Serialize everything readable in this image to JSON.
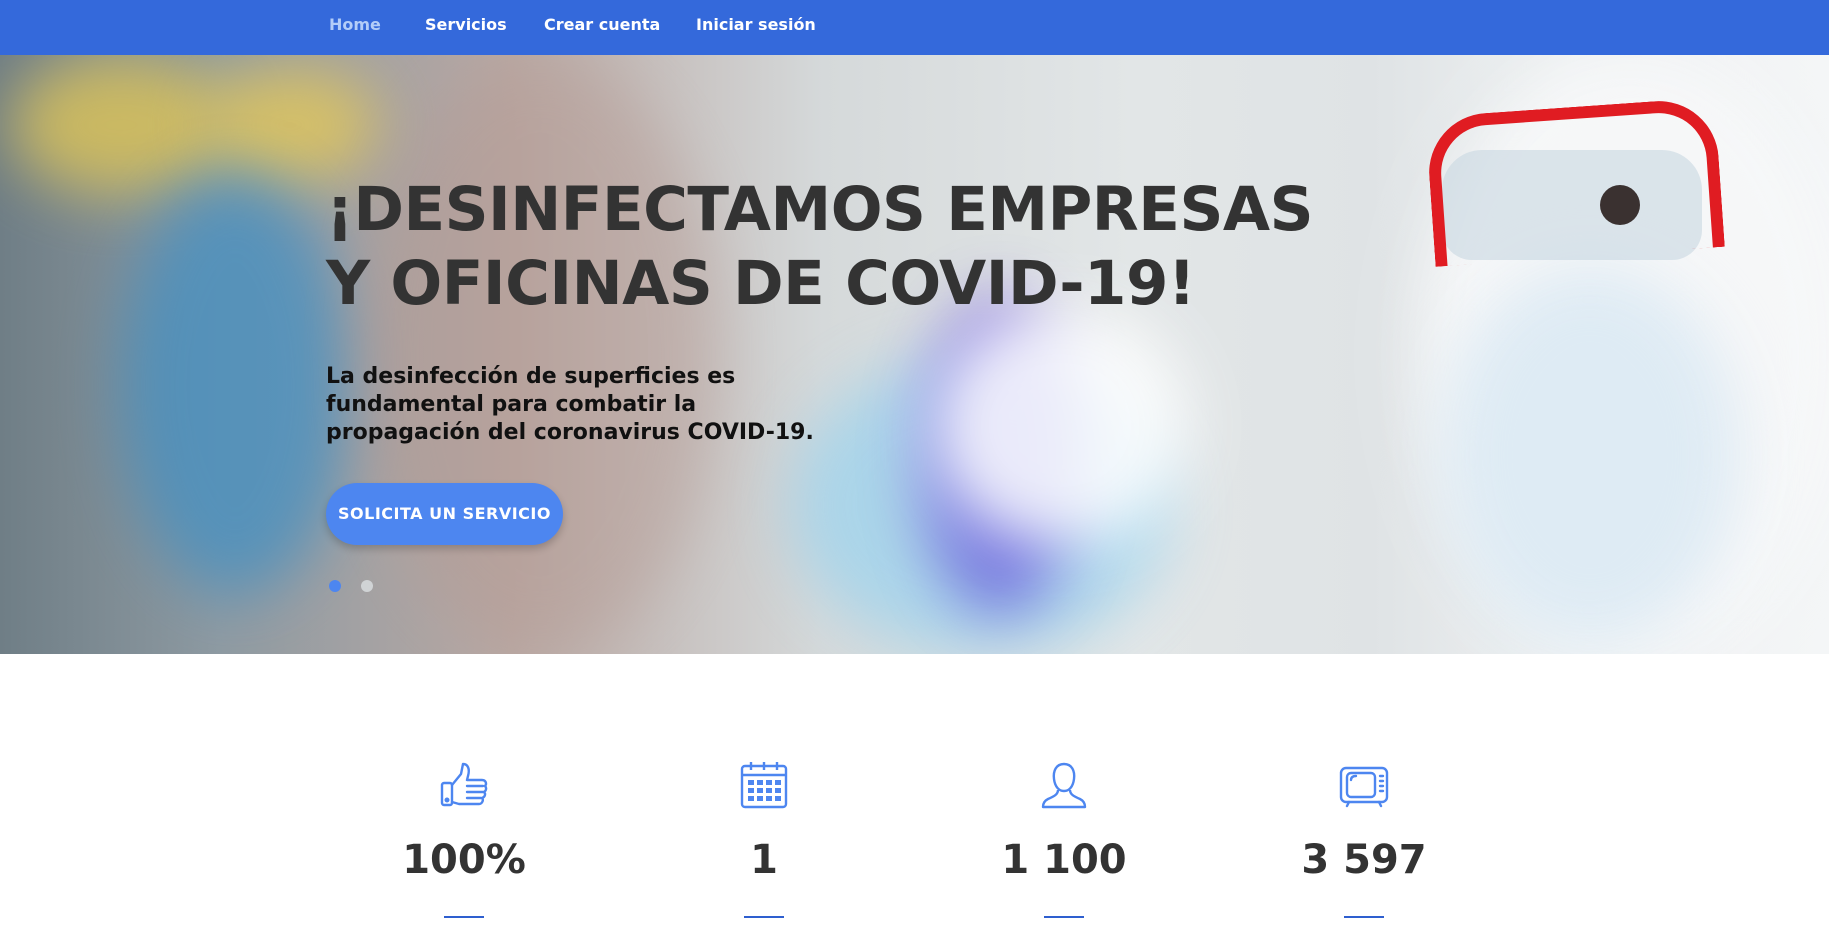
{
  "nav": {
    "items": [
      {
        "label": "Home",
        "active": true
      },
      {
        "label": "Servicios"
      },
      {
        "label": "Crear cuenta"
      },
      {
        "label": "Iniciar sesión"
      }
    ],
    "background_color": "#3469db",
    "active_color": "#b3cdf8"
  },
  "hero": {
    "title_line1": "¡DESINFECTAMOS EMPRESAS",
    "title_line2": "Y OFICINAS DE COVID-19!",
    "text_line1": "La desinfección de superficies es",
    "text_line2": "fundamental para combatir la",
    "text_line3": "propagación del coronavirus COVID-19.",
    "button_label": "SOLICITA UN SERVICIO",
    "accent_color": "#4d86f0",
    "slider": {
      "total": 2,
      "active": 1
    }
  },
  "stats": [
    {
      "icon": "thumbs-up-icon",
      "value": "100%"
    },
    {
      "icon": "calendar-icon",
      "value": "1"
    },
    {
      "icon": "user-icon",
      "value": "1 100"
    },
    {
      "icon": "tv-icon",
      "value": "3 597"
    }
  ]
}
